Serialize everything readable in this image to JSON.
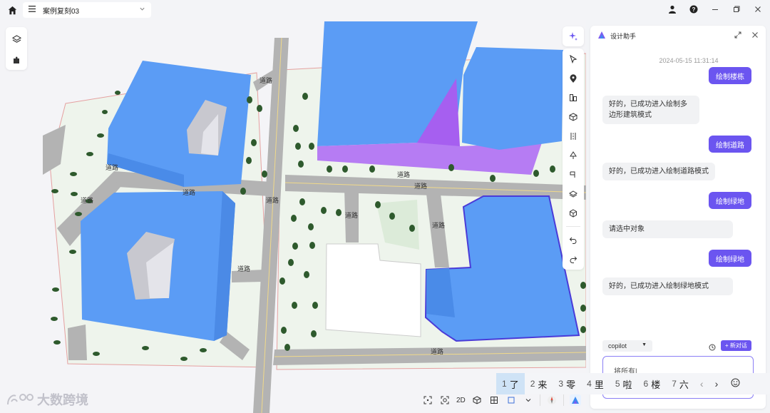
{
  "topbar": {
    "file_name": "案例复刻03"
  },
  "map": {
    "road_labels": [
      "道路",
      "道路",
      "道路",
      "道路",
      "道路",
      "道路",
      "道路",
      "道路",
      "道路",
      "道路",
      "道路"
    ]
  },
  "bottom_toolbar": {
    "view_2d": "2D"
  },
  "watermark": {
    "text": "大数跨境"
  },
  "assistant": {
    "title": "设计助手",
    "timestamp": "2024-05-15 11:31:14",
    "messages": [
      {
        "role": "user",
        "text": "绘制楼栋"
      },
      {
        "role": "bot",
        "text": "好的，已成功进入绘制多边形建筑模式"
      },
      {
        "role": "user",
        "text": "绘制道路"
      },
      {
        "role": "bot",
        "text": "好的，已成功进入绘制道路模式"
      },
      {
        "role": "user",
        "text": "绘制绿地"
      },
      {
        "role": "bot",
        "text": "请选中对象"
      },
      {
        "role": "user",
        "text": "绘制绿地"
      },
      {
        "role": "bot",
        "text": "好的，已成功进入绘制绿地模式"
      }
    ],
    "model": "copilot",
    "new_chat_label": "+ 新对话",
    "input_value": "将所有|"
  },
  "ime": {
    "candidates": [
      {
        "num": "1",
        "text": "了"
      },
      {
        "num": "2",
        "text": "来"
      },
      {
        "num": "3",
        "text": "零"
      },
      {
        "num": "4",
        "text": "里"
      },
      {
        "num": "5",
        "text": "啦"
      },
      {
        "num": "6",
        "text": "楼"
      },
      {
        "num": "7",
        "text": "六"
      }
    ]
  },
  "colors": {
    "accent": "#6b55f0",
    "building_blue": "#5b9cf5",
    "building_purple": "#b67cf3",
    "green_space": "#e4f0e3",
    "road": "#b3b3b3"
  }
}
